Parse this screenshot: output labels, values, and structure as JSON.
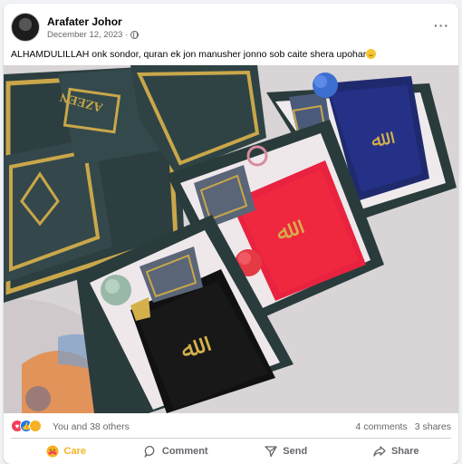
{
  "post": {
    "author": "Arafater Johor",
    "date": "December 12, 2023 ·",
    "more_icon": "more-horizontal-icon",
    "caption": "ALHAMDULILLAH onk sondor, quran ek jon manusher jonno sob caite shera upohar",
    "image_alt": "Quran gift boxes with velvet covers in blue, red and black"
  },
  "photo": {
    "box_brand": "AZEEN"
  },
  "stats": {
    "reactions_text": "You and 38 others",
    "comments": "4 comments",
    "shares": "3 shares"
  },
  "actions": {
    "care": "Care",
    "comment": "Comment",
    "send": "Send",
    "share": "Share"
  },
  "colors": {
    "care": "#f7b125",
    "like": "#1877f2",
    "love": "#f33e58",
    "secondary_text": "#65676b"
  }
}
